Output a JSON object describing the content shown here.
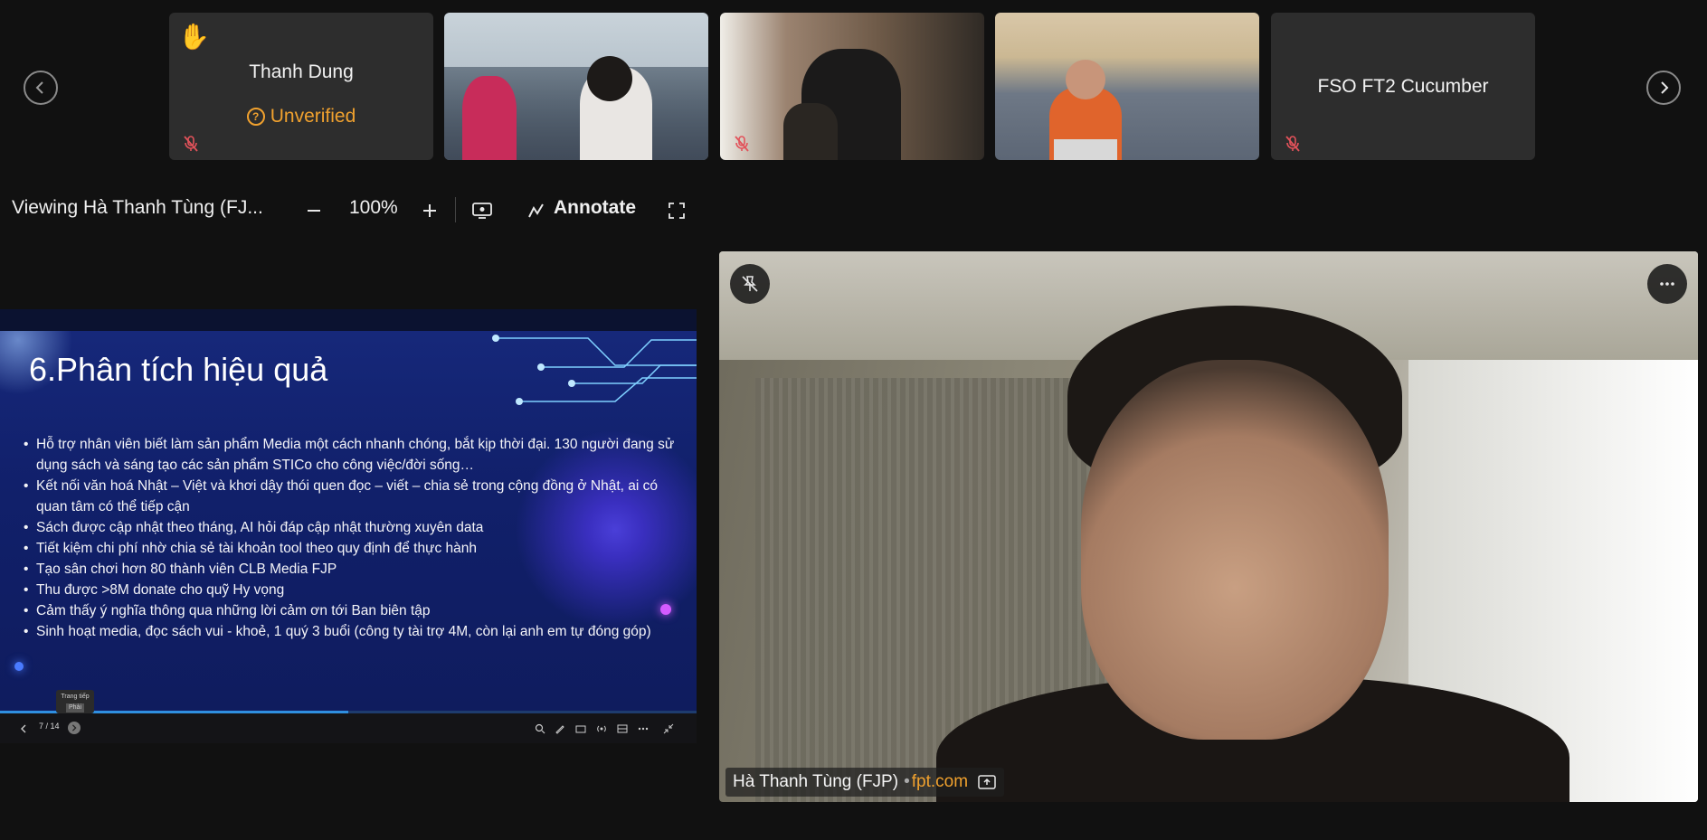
{
  "participants": [
    {
      "name": "Thanh Dung",
      "status": "Unverified",
      "hand_raised": true,
      "muted": true
    },
    {
      "name": "",
      "video": true
    },
    {
      "name": "",
      "video": true,
      "muted": true
    },
    {
      "name": "",
      "video": true
    },
    {
      "name": "FSO FT2 Cucumber",
      "muted": true
    }
  ],
  "toolbar": {
    "viewing_label": "Viewing Hà Thanh Tùng (FJ...",
    "zoom_level": "100%",
    "annotate_label": "Annotate"
  },
  "slide": {
    "title": "6.Phân tích hiệu quả",
    "bullets": [
      "Hỗ trợ nhân viên biết làm sản phẩm Media một cách nhanh chóng, bắt kịp thời đại. 130 người đang sử dụng sách và sáng tạo các sản phẩm STICo cho công việc/đời sống…",
      "Kết nối văn hoá Nhật – Việt và khơi dậy thói quen đọc – viết – chia sẻ trong cộng đồng ở Nhật, ai có quan tâm có thể tiếp cận",
      "Sách được cập nhật theo tháng, AI hỏi đáp cập nhật thường xuyên data",
      "Tiết kiệm chi phí nhờ chia sẻ tài khoản tool theo quy định để thực hành",
      "Tạo sân chơi hơn 80 thành viên CLB Media FJP",
      "Thu được >8M donate cho quỹ Hy vọng",
      "Cảm thấy ý nghĩa thông qua những lời cảm ơn tới Ban biên tập",
      "Sinh hoạt media, đọc sách vui - khoẻ, 1 quý 3 buổi (công ty tài trợ 4M, còn lại anh em tự đóng góp)"
    ],
    "page_indicator": "7 / 14",
    "progress_fraction": 0.5,
    "tooltip_title": "Trang tiếp",
    "tooltip_sub": "Phải"
  },
  "main_video": {
    "name": "Hà Thanh Tùng (FJP)",
    "separator": "•",
    "domain": "fpt.com"
  },
  "colors": {
    "accent_orange": "#f0a12e",
    "background": "#111111",
    "tile_bg": "#2d2d2d"
  },
  "icons": {
    "prev": "chevron-left-icon",
    "next": "chevron-right-icon",
    "hand": "raised-hand-icon",
    "mic_off": "mic-off-icon",
    "zoom_out": "minus-icon",
    "zoom_in": "plus-icon",
    "share_screen": "screen-icon",
    "annotate": "pen-icon",
    "fullscreen": "expand-icon",
    "unpin": "unpin-icon",
    "more": "more-icon",
    "popout": "popout-icon"
  }
}
